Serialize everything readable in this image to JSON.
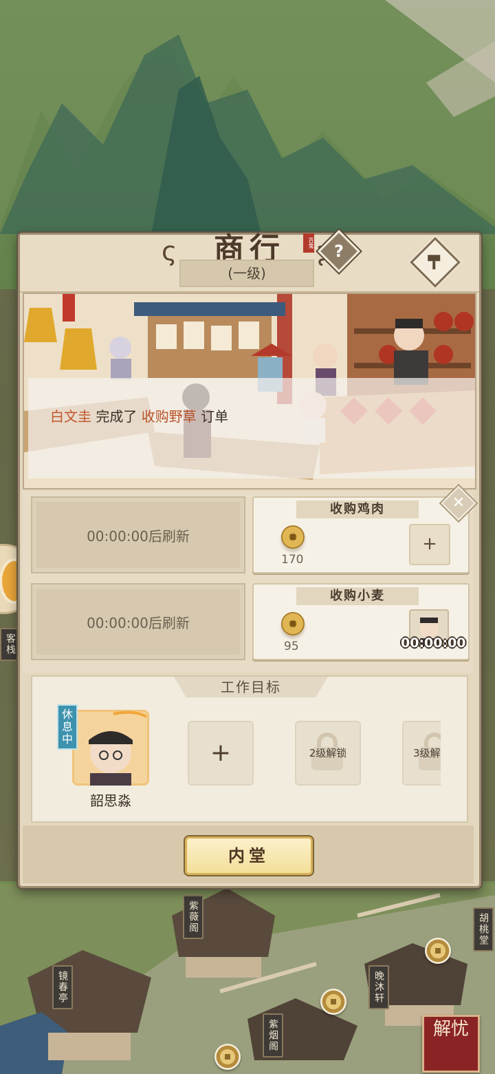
{
  "panel": {
    "title": "商行",
    "seal_text": "百鬼",
    "help_label": "?",
    "level": "(一级)"
  },
  "notice": {
    "actor": "白文圭",
    "verb": "完成了",
    "order_name": "收购野草",
    "suffix": "订单"
  },
  "orders": [
    {
      "refresh_text": "00:00:00后刷新",
      "title": "收购鸡肉",
      "reward": "170",
      "action": "+"
    },
    {
      "refresh_text": "00:00:00后刷新",
      "title": "收购小麦",
      "reward": "95",
      "timer": "00:00:00"
    }
  ],
  "close_label": "✕",
  "work": {
    "title": "工作目标",
    "status": "休息中",
    "worker_name": "韶思淼",
    "add_label": "+",
    "locked": [
      "2级解锁",
      "3级解"
    ]
  },
  "bottom_button": "内堂",
  "side_tags": [
    "客栈",
    "紫薇阁",
    "胡桃堂",
    "镜春亭",
    "晚沐轩",
    "紫烟阁"
  ],
  "corner_badge": "解忧",
  "icons": [
    "help-icon",
    "hammer-icon",
    "close-icon",
    "coin-icon",
    "lock-icon",
    "plus-icon"
  ],
  "colors": {
    "panel_bg": "#e4d7bf",
    "accent_text": "#c0562c",
    "button_gold": "#f3df9a",
    "rest_tag": "#3d92ae"
  }
}
